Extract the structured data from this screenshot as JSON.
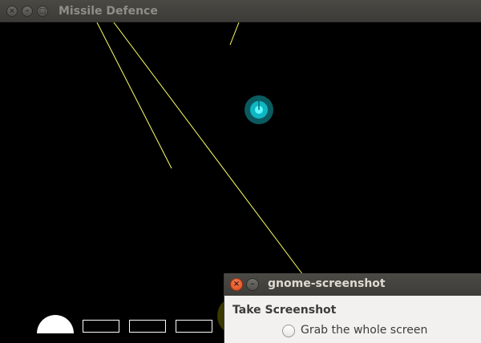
{
  "window": {
    "title": "Missile Defence",
    "controls": {
      "close": "×",
      "minimize": "–",
      "maximize": "□"
    }
  },
  "game": {
    "missile_color": "#ffff66",
    "target_color": "#00ffff",
    "base_count": 4
  },
  "dialog": {
    "title": "gnome-screenshot",
    "heading": "Take Screenshot",
    "option_label": "Grab the whole screen",
    "close_glyph": "×",
    "minimize_glyph": "–"
  }
}
